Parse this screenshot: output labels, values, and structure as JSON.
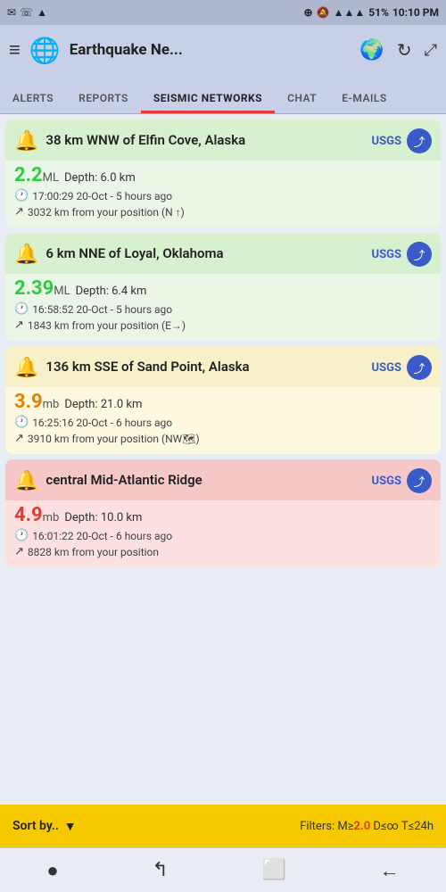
{
  "statusBar": {
    "left": [
      "✉",
      "☏",
      "📶"
    ],
    "signal": "📶",
    "battery": "51%",
    "time": "10:10 PM",
    "icons": "◎ 🔕 📶 51%"
  },
  "header": {
    "menuIcon": "≡",
    "globeIcon": "🌐",
    "title": "Earthquake Ne...",
    "globeRightIcon": "🌍",
    "refreshIcon": "↻",
    "expandIcon": "⤢"
  },
  "tabs": [
    {
      "id": "alerts",
      "label": "ALERTS",
      "active": false
    },
    {
      "id": "reports",
      "label": "REPORTS",
      "active": false
    },
    {
      "id": "seismic",
      "label": "SEISMIC NETWORKS",
      "active": true
    },
    {
      "id": "chat",
      "label": "CHAT",
      "active": false
    },
    {
      "id": "emails",
      "label": "E-MAILS",
      "active": false
    }
  ],
  "earthquakes": [
    {
      "id": "eq1",
      "location": "38 km WNW of Elfin Cove, Alaska",
      "magnitude": "2.2",
      "magType": "ML",
      "depth": "Depth: 6.0 km",
      "time": "17:00:29 20-Oct - 5 hours ago",
      "distance": "3032 km from your position (N ↑)",
      "source": "USGS",
      "colorClass": "card-green",
      "magColorClass": "mag-green"
    },
    {
      "id": "eq2",
      "location": "6 km NNE of Loyal, Oklahoma",
      "magnitude": "2.39",
      "magType": "ML",
      "depth": "Depth: 6.4 km",
      "time": "16:58:52 20-Oct - 5 hours ago",
      "distance": "1843 km from your position (E→)",
      "source": "USGS",
      "colorClass": "card-green",
      "magColorClass": "mag-green"
    },
    {
      "id": "eq3",
      "location": "136 km SSE of Sand Point, Alaska",
      "magnitude": "3.9",
      "magType": "mb",
      "depth": "Depth: 21.0 km",
      "time": "16:25:16 20-Oct - 6 hours ago",
      "distance": "3910 km from your position (NW🗺)",
      "source": "USGS",
      "colorClass": "card-yellow",
      "magColorClass": "mag-orange"
    },
    {
      "id": "eq4",
      "location": "central Mid-Atlantic Ridge",
      "magnitude": "4.9",
      "magType": "mb",
      "depth": "Depth: 10.0 km",
      "time": "16:01:22 20-Oct - 6 hours ago",
      "distance": "8828 km from your position",
      "source": "USGS",
      "colorClass": "card-pink",
      "magColorClass": "mag-red"
    }
  ],
  "bottomBar": {
    "sortLabel": "Sort by..",
    "filterPrefix": "Filters: M≥",
    "filterMag": "2.0",
    "filterSuffix": " D≤∞ T≤24h"
  },
  "navBar": {
    "dotIcon": "●",
    "replyIcon": "↰",
    "squareIcon": "⬜",
    "backIcon": "←"
  }
}
